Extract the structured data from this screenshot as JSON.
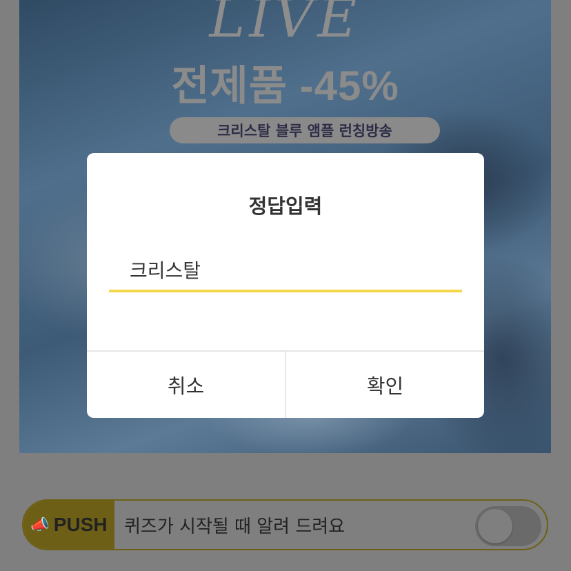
{
  "banner": {
    "title": "LIVE",
    "sale_text": "전제품 -45%",
    "pill_text": "크리스탈 블루 앰플 런칭방송"
  },
  "dialog": {
    "title": "정답입력",
    "answer_value": "크리스탈",
    "cancel_label": "취소",
    "confirm_label": "확인"
  },
  "push_bar": {
    "badge_icon": "megaphone-icon",
    "badge_label": "PUSH",
    "message": "퀴즈가 시작될 때 알려 드려요",
    "toggle_on": false
  },
  "colors": {
    "accent_yellow": "#f6d74a",
    "push_badge": "#6d6016",
    "dim_overlay": "#7f7f7f"
  }
}
